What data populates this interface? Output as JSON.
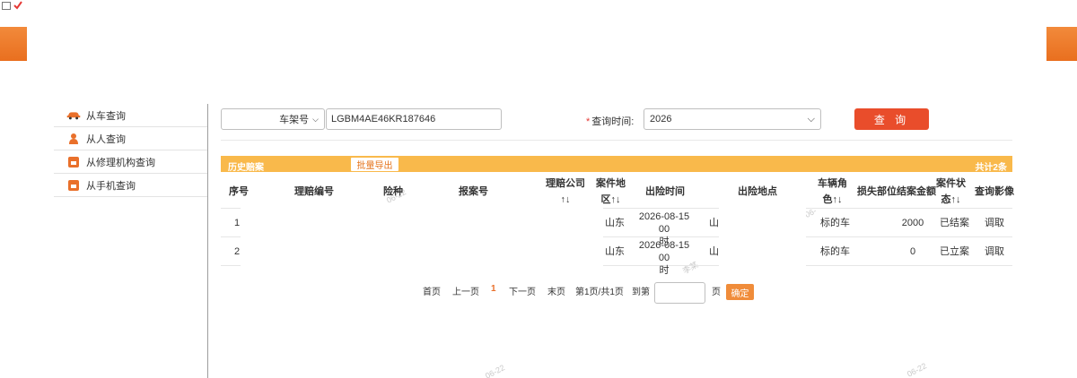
{
  "sidebar": {
    "items": [
      {
        "label": "从车查询",
        "icon": "car-icon"
      },
      {
        "label": "从人查询",
        "icon": "person-icon"
      },
      {
        "label": "从修理机构查询",
        "icon": "repair-shop-icon"
      },
      {
        "label": "从手机查询",
        "icon": "phone-icon"
      }
    ]
  },
  "search": {
    "type_selected": "车架号",
    "vin_value": "LGBM4AE46KR187646",
    "query_time_label": "查询时间:",
    "query_time_value": "2026",
    "search_label": "查 询"
  },
  "table": {
    "title": "历史赔案",
    "export_label": "批量导出",
    "total": "共计2条",
    "headers": {
      "seq": "序号",
      "claim_no": "理赔编号",
      "insurance": "险种",
      "report_no": "报案号",
      "company_l1": "理赔公司",
      "company_l2": "↑↓",
      "region_l1": "案件地",
      "region_l2": "区↑↓",
      "time": "出险时间",
      "place": "出险地点",
      "role_l1": "车辆角",
      "role_l2": "色↑↓",
      "damage": "损失部位",
      "amount": "结案金额",
      "status_l1": "案件状",
      "status_l2": "态↑↓",
      "image": "查询影像"
    },
    "rows": [
      {
        "seq": "1",
        "region": "山东",
        "time_l1": "2026-08-15 00",
        "time_l2": "时",
        "place": "山",
        "role": "标的车",
        "amount": "2000",
        "status": "已结案",
        "image": "调取"
      },
      {
        "seq": "2",
        "region": "山东",
        "time_l1": "2026-08-15 00",
        "time_l2": "时",
        "place": "山",
        "role": "标的车",
        "amount": "0",
        "status": "已立案",
        "image": "调取"
      }
    ]
  },
  "pagination": {
    "first": "首页",
    "prev": "上一页",
    "current": "1",
    "next": "下一页",
    "last": "末页",
    "info": "第1页/共1页",
    "goto": "到第",
    "page_unit": "页",
    "confirm": "确定"
  },
  "colors": {
    "orange_bar": "#f9b94b",
    "search_button": "#e94d2b",
    "accent": "#e9702b"
  }
}
